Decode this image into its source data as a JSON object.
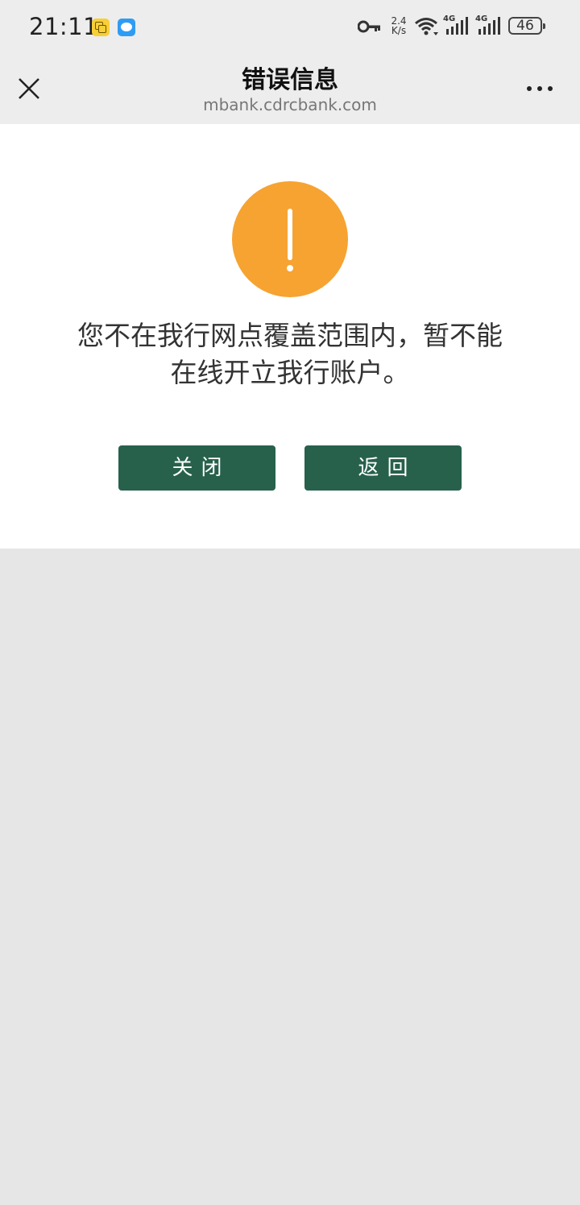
{
  "status_bar": {
    "time": "21:11",
    "net_speed_value": "2.4",
    "net_speed_unit": "K/s",
    "signal1_label": "4G",
    "signal2_label": "4G",
    "battery_level": "46",
    "icons": [
      "app-notification-yellow-icon",
      "message-bubble-icon",
      "vpn-key-icon",
      "wifi-icon",
      "signal-icon",
      "signal-icon",
      "battery-icon"
    ]
  },
  "header": {
    "title": "错误信息",
    "subtitle": "mbank.cdrcbank.com",
    "icons": [
      "close-icon",
      "more-icon"
    ]
  },
  "content": {
    "icon": "warning-icon",
    "icon_color": "#f6a332",
    "message_line1": "您不在我行网点覆盖范围内，暂不能",
    "message_line2": "在线开立我行账户。",
    "buttons": {
      "close_label": "关闭",
      "back_label": "返回",
      "color": "#27614c"
    }
  }
}
